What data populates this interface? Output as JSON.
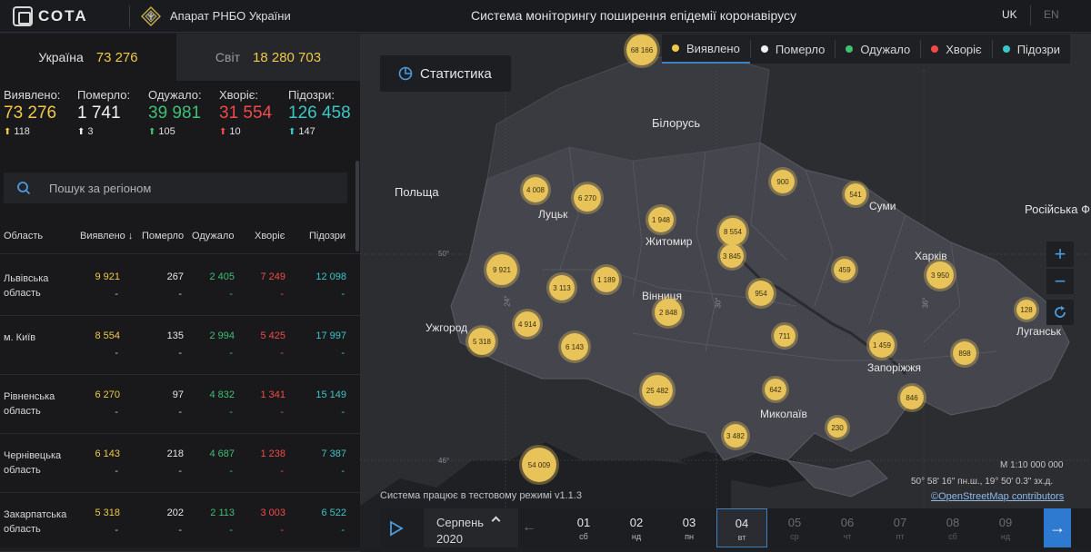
{
  "header": {
    "logo_text": "СОТА",
    "org_name": "Апарат РНБО України",
    "system_title": "Система моніторингу поширення епідемії коронавірусу",
    "lang_uk": "UK",
    "lang_en": "EN"
  },
  "tabs": {
    "ukraine_label": "Україна",
    "ukraine_value": "73 276",
    "world_label": "Світ",
    "world_value": "18 280 703"
  },
  "stats": [
    {
      "label": "Виявлено:",
      "value": "73 276",
      "delta": "118",
      "color": "#f0c94a",
      "arrow_color": "#f0c94a"
    },
    {
      "label": "Померло:",
      "value": "1 741",
      "delta": "3",
      "color": "#f2f2f2",
      "arrow_color": "#f2f2f2"
    },
    {
      "label": "Одужало:",
      "value": "39 981",
      "delta": "105",
      "color": "#3fbf74",
      "arrow_color": "#3fbf74"
    },
    {
      "label": "Хворіє:",
      "value": "31 554",
      "delta": "10",
      "color": "#f24a4a",
      "arrow_color": "#f24a4a"
    },
    {
      "label": "Підозри:",
      "value": "126 458",
      "delta": "147",
      "color": "#3bc6c6",
      "arrow_color": "#3bc6c6"
    }
  ],
  "search": {
    "placeholder": "Пошук за регіоном"
  },
  "table": {
    "headers": {
      "region": "Область",
      "detected": "Виявлено",
      "sort_arrow": "↓",
      "died": "Померло",
      "recovered": "Одужало",
      "sick": "Хворіє",
      "suspected": "Підозри"
    },
    "rows": [
      {
        "name": "Львівська область",
        "detected": "9 921",
        "died": "267",
        "recovered": "2 405",
        "sick": "7 249",
        "suspected": "12 098"
      },
      {
        "name": "м. Київ",
        "detected": "8 554",
        "died": "135",
        "recovered": "2 994",
        "sick": "5 425",
        "suspected": "17 997"
      },
      {
        "name": "Рівненська область",
        "detected": "6 270",
        "died": "97",
        "recovered": "4 832",
        "sick": "1 341",
        "suspected": "15 149"
      },
      {
        "name": "Чернівецька область",
        "detected": "6 143",
        "died": "218",
        "recovered": "4 687",
        "sick": "1 238",
        "suspected": "7 387"
      },
      {
        "name": "Закарпатська область",
        "detected": "5 318",
        "died": "202",
        "recovered": "2 113",
        "sick": "3 003",
        "suspected": "6 522"
      }
    ],
    "dash": "-"
  },
  "legend": [
    {
      "label": "Виявлено",
      "color": "#f0c94a"
    },
    {
      "label": "Померло",
      "color": "#f2f2f2"
    },
    {
      "label": "Одужало",
      "color": "#3fbf74"
    },
    {
      "label": "Хворіє",
      "color": "#f24a4a"
    },
    {
      "label": "Підозри",
      "color": "#3bc6c6"
    }
  ],
  "statistics_button": "Статистика",
  "map": {
    "countries": {
      "belarus": "Білорусь",
      "poland": "Польща",
      "russia": "Російська Ф"
    },
    "cities": {
      "lutsk": "Луцьк",
      "zhytomyr": "Житомир",
      "sumy": "Суми",
      "kharkiv": "Харків",
      "vinnytsia": "Вінниця",
      "uzhhorod": "Ужгород",
      "luhansk": "Луганськ",
      "zaporizhzhia": "Запоріжжя",
      "mykolaiv": "Миколаїв"
    },
    "bubbles": [
      {
        "id": "top",
        "value": "68 166"
      },
      {
        "id": "lutsk",
        "value": "4 008"
      },
      {
        "id": "rivne",
        "value": "6 270"
      },
      {
        "id": "zhytomyr",
        "value": "1 948"
      },
      {
        "id": "kyiv-city",
        "value": "8 554"
      },
      {
        "id": "kyiv-oblast",
        "value": "3 845"
      },
      {
        "id": "chernihiv",
        "value": "900"
      },
      {
        "id": "sumy",
        "value": "541"
      },
      {
        "id": "lviv",
        "value": "9 921"
      },
      {
        "id": "ternopil",
        "value": "3 113"
      },
      {
        "id": "khmelnytskyi",
        "value": "1 189"
      },
      {
        "id": "vinnytsia",
        "value": "2 848"
      },
      {
        "id": "cherkasy",
        "value": "954"
      },
      {
        "id": "poltava",
        "value": "459"
      },
      {
        "id": "kharkiv",
        "value": "3 950"
      },
      {
        "id": "luhansk",
        "value": "128"
      },
      {
        "id": "ivano-frankivsk",
        "value": "4 914"
      },
      {
        "id": "zakarpattia",
        "value": "5 318"
      },
      {
        "id": "chernivtsi",
        "value": "6 143"
      },
      {
        "id": "kirovohrad",
        "value": "711"
      },
      {
        "id": "dnipro",
        "value": "1 459"
      },
      {
        "id": "donetsk",
        "value": "898"
      },
      {
        "id": "odesa",
        "value": "25 482"
      },
      {
        "id": "mykolaiv",
        "value": "642"
      },
      {
        "id": "zaporizhzhia",
        "value": "846"
      },
      {
        "id": "kherson",
        "value": "230"
      },
      {
        "id": "crimea",
        "value": "3 482"
      },
      {
        "id": "bottom",
        "value": "54 009"
      }
    ],
    "grid_labels": {
      "lat50": "50°",
      "lat46": "46°",
      "lon24": "24°",
      "lon30": "30°",
      "lon36": "36°"
    },
    "scale": "М 1:10 000 000",
    "coordinates": "50° 58' 16\" пн.ш., 19° 50' 0.3\" зх.д.",
    "osm": "©OpenStreetMap contributors",
    "system_note": "Система працює в тестовому режимі v1.1.3"
  },
  "timeline": {
    "month": "Серпень",
    "year": "2020",
    "days": [
      {
        "num": "01",
        "wd": "сб",
        "state": "past"
      },
      {
        "num": "02",
        "wd": "нд",
        "state": "past"
      },
      {
        "num": "03",
        "wd": "пн",
        "state": "past"
      },
      {
        "num": "04",
        "wd": "вт",
        "state": "active"
      },
      {
        "num": "05",
        "wd": "ср",
        "state": "future"
      },
      {
        "num": "06",
        "wd": "чт",
        "state": "future"
      },
      {
        "num": "07",
        "wd": "пт",
        "state": "future"
      },
      {
        "num": "08",
        "wd": "сб",
        "state": "future"
      },
      {
        "num": "09",
        "wd": "нд",
        "state": "future"
      }
    ]
  },
  "icons": {
    "search": "search-icon",
    "statistics": "pie-chart-icon",
    "play": "play-icon",
    "next": "arrow-right-icon",
    "prev": "arrow-left-icon",
    "zoom_in": "plus-icon",
    "zoom_out": "minus-icon",
    "refresh": "refresh-icon"
  }
}
